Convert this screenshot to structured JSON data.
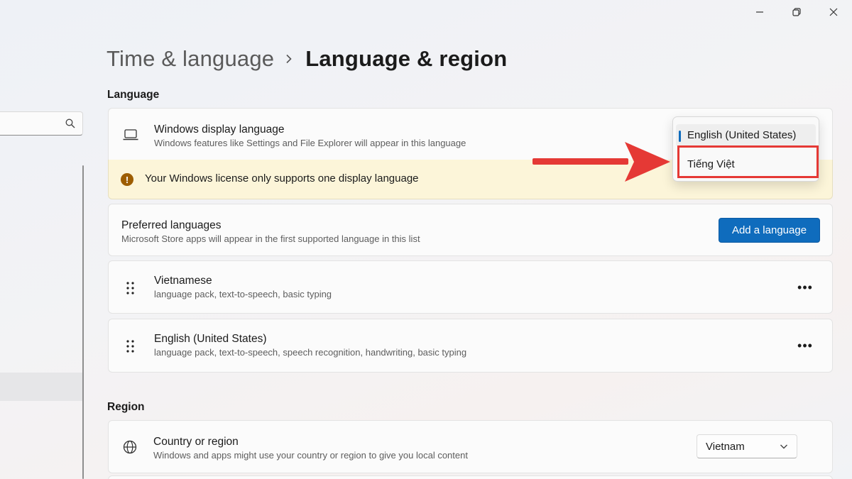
{
  "window": {
    "minimize_icon": "minimize-icon",
    "restore_icon": "restore-icon",
    "close_icon": "close-icon"
  },
  "breadcrumb": {
    "parent": "Time & language",
    "current": "Language & region"
  },
  "language_section": {
    "label": "Language",
    "display_language": {
      "title": "Windows display language",
      "subtitle": "Windows features like Settings and File Explorer will appear in this language",
      "icon": "laptop-icon",
      "dropdown_options": [
        "English (United States)",
        "Tiếng Việt"
      ],
      "selected_option": "English (United States)",
      "highlighted_option": "Tiếng Việt"
    },
    "warning": {
      "icon": "warning-icon",
      "text": "Your Windows license only supports one display language"
    },
    "preferred": {
      "title": "Preferred languages",
      "subtitle": "Microsoft Store apps will appear in the first supported language in this list",
      "add_button": "Add a language"
    },
    "languages": [
      {
        "name": "Vietnamese",
        "features": "language pack, text-to-speech, basic typing"
      },
      {
        "name": "English (United States)",
        "features": "language pack, text-to-speech, speech recognition, handwriting, basic typing"
      }
    ],
    "more_label": "•••"
  },
  "region_section": {
    "label": "Region",
    "country": {
      "title": "Country or region",
      "subtitle": "Windows and apps might use your country or region to give you local content",
      "icon": "globe-icon",
      "value": "Vietnam"
    }
  },
  "colors": {
    "accent": "#0f6cbd",
    "warning_bg": "#fcf5d9",
    "annotation_red": "#e53935"
  }
}
